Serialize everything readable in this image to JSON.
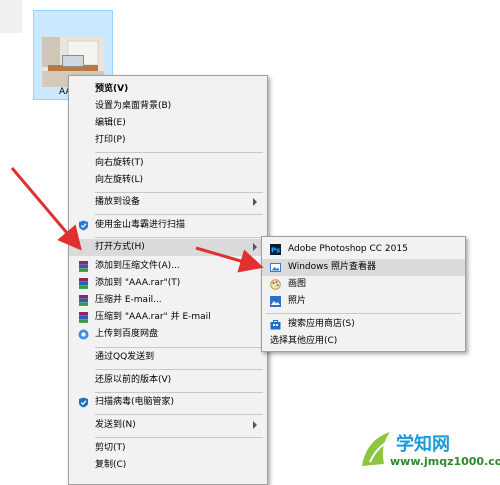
{
  "file": {
    "label": "AA"
  },
  "context_menu": {
    "items": [
      {
        "label": "预览(V)",
        "bold": true
      },
      {
        "label": "设置为桌面背景(B)"
      },
      {
        "label": "编辑(E)"
      },
      {
        "label": "打印(P)"
      },
      {
        "label": "向右旋转(T)"
      },
      {
        "label": "向左旋转(L)"
      },
      {
        "label": "播放到设备"
      },
      {
        "label": "使用金山毒霸进行扫描"
      },
      {
        "label": "打开方式(H)"
      },
      {
        "label": "添加到压缩文件(A)..."
      },
      {
        "label": "添加到 \"AAA.rar\"(T)"
      },
      {
        "label": "压缩并 E-mail..."
      },
      {
        "label": "压缩到 \"AAA.rar\" 并 E-mail"
      },
      {
        "label": "上传到百度网盘"
      },
      {
        "label": "通过QQ发送到"
      },
      {
        "label": "还原以前的版本(V)"
      },
      {
        "label": "扫描病毒(电脑管家)"
      },
      {
        "label": "发送到(N)"
      },
      {
        "label": "剪切(T)"
      },
      {
        "label": "复制(C)"
      }
    ]
  },
  "open_with_menu": {
    "items": [
      {
        "label": "Adobe Photoshop CC 2015",
        "icon": "photoshop-icon",
        "color": "#001e36"
      },
      {
        "label": "Windows 照片查看器",
        "icon": "photo-viewer-icon",
        "color": "#3a7bd5"
      },
      {
        "label": "画图",
        "icon": "paint-icon",
        "color": "#e8a030"
      },
      {
        "label": "照片",
        "icon": "photos-icon",
        "color": "#2b73c8"
      },
      {
        "label": "搜索应用商店(S)",
        "icon": "store-icon",
        "color": "#1e6fc9"
      },
      {
        "label": "选择其他应用(C)",
        "icon": "",
        "color": ""
      }
    ]
  },
  "watermark": {
    "title": "学知网",
    "url": "www.jmqz1000.com"
  },
  "colors": {
    "selection": "#cce8ff",
    "arrow": "#e03030",
    "menu_bg": "#f2f2f2",
    "highlight": "#dadada"
  }
}
